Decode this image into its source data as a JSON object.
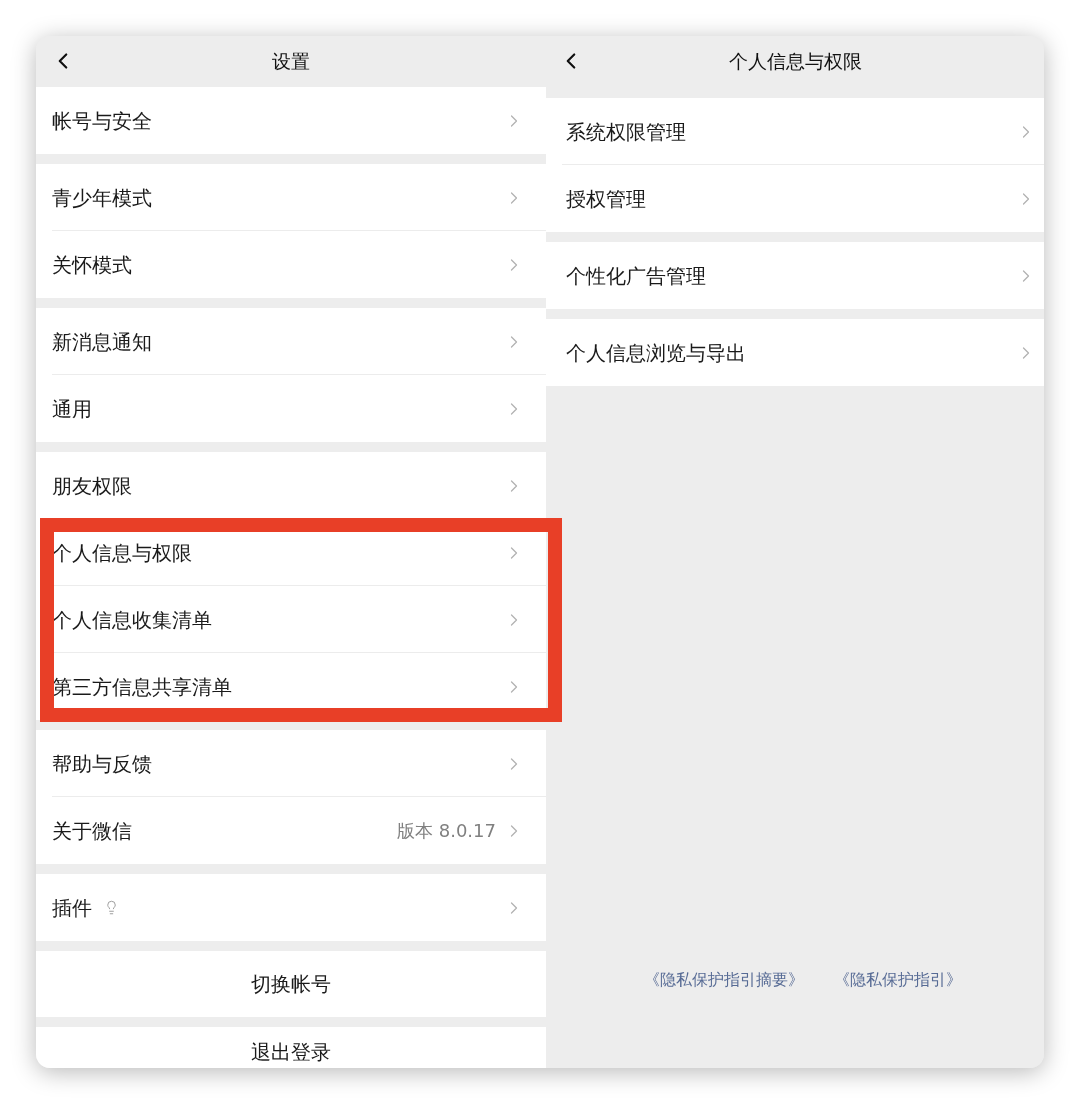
{
  "left_screen": {
    "title": "设置",
    "groups": [
      {
        "items": [
          {
            "label": "帐号与安全",
            "highlighted": false
          }
        ]
      },
      {
        "items": [
          {
            "label": "青少年模式",
            "highlighted": false
          },
          {
            "label": "关怀模式",
            "highlighted": false
          }
        ]
      },
      {
        "items": [
          {
            "label": "新消息通知",
            "highlighted": false
          },
          {
            "label": "通用",
            "highlighted": false
          }
        ]
      },
      {
        "items": [
          {
            "label": "朋友权限",
            "highlighted": false
          },
          {
            "label": "个人信息与权限",
            "highlighted": true
          },
          {
            "label": "个人信息收集清单",
            "highlighted": true
          },
          {
            "label": "第三方信息共享清单",
            "highlighted": true
          }
        ]
      },
      {
        "items": [
          {
            "label": "帮助与反馈",
            "highlighted": false
          },
          {
            "label": "关于微信",
            "value": "版本 8.0.17",
            "highlighted": false
          }
        ]
      },
      {
        "items": [
          {
            "label": "插件",
            "kind": "plugin",
            "highlighted": false
          }
        ]
      }
    ],
    "actions": [
      "切换帐号",
      "退出登录"
    ]
  },
  "right_screen": {
    "title": "个人信息与权限",
    "groups": [
      {
        "items": [
          {
            "label": "系统权限管理"
          },
          {
            "label": "授权管理"
          }
        ]
      },
      {
        "items": [
          {
            "label": "个性化广告管理"
          }
        ]
      },
      {
        "items": [
          {
            "label": "个人信息浏览与导出"
          }
        ]
      }
    ],
    "links": [
      "《隐私保护指引摘要》",
      "《隐私保护指引》"
    ]
  }
}
